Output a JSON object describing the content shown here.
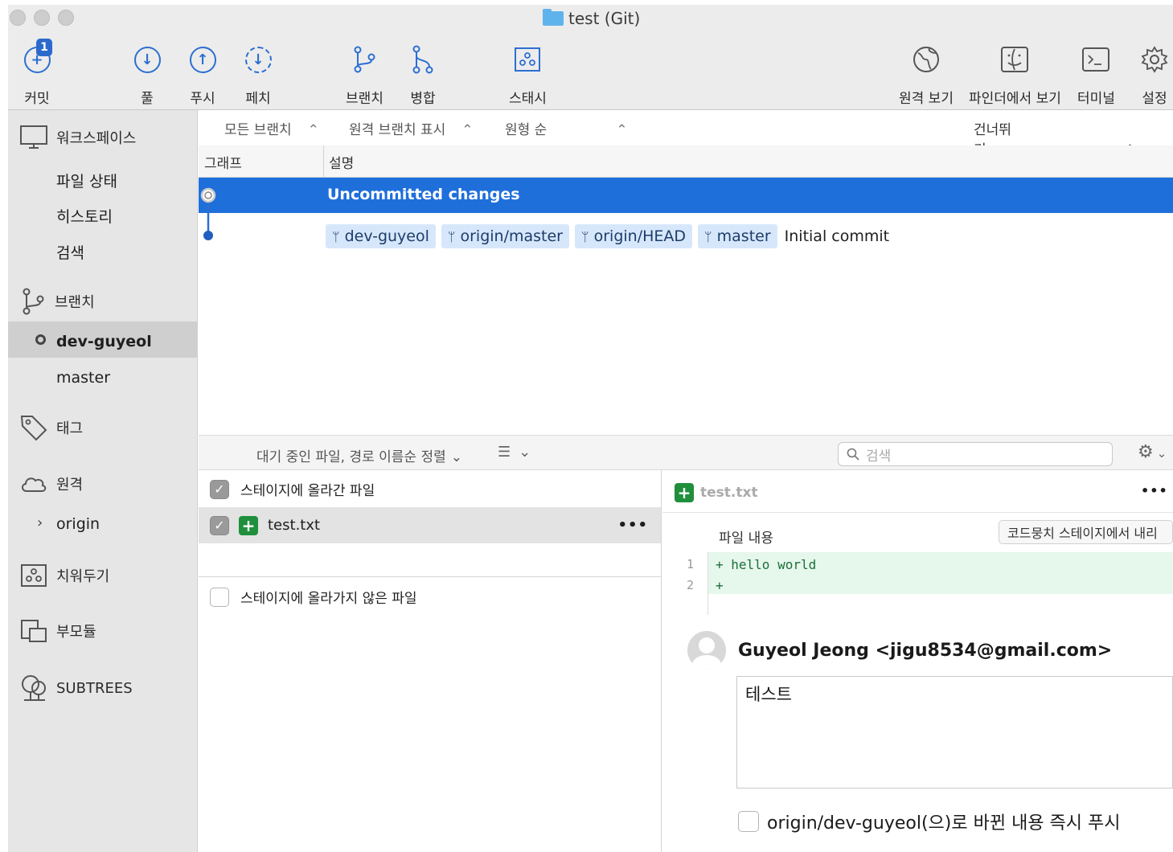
{
  "window": {
    "title": "test (Git)"
  },
  "toolbar": {
    "commit": {
      "label": "커밋",
      "badge": "1"
    },
    "pull": "풀",
    "push": "푸시",
    "fetch": "페치",
    "branch": "브랜치",
    "merge": "병합",
    "stash": "스태시",
    "remote_view": "원격 보기",
    "finder": "파인더에서 보기",
    "terminal": "터미널",
    "settings": "설정"
  },
  "sidebar": {
    "workspace": {
      "header": "워크스페이스",
      "items": [
        "파일 상태",
        "히스토리",
        "검색"
      ]
    },
    "branches": {
      "header": "브랜치",
      "items": [
        "dev-guyeol",
        "master"
      ]
    },
    "tags": {
      "header": "태그"
    },
    "remotes": {
      "header": "원격",
      "items": [
        "origin"
      ]
    },
    "stashes": {
      "header": "치워두기"
    },
    "submodules": {
      "header": "부모듈"
    },
    "subtrees": {
      "header": "SUBTREES"
    }
  },
  "filter": {
    "branches": "모든 브랜치",
    "remote": "원격 브랜치 표시",
    "order": "원형 순",
    "jump": "건너뛰기:"
  },
  "columns": {
    "graph": "그래프",
    "description": "설명"
  },
  "commits": [
    {
      "text": "Uncommitted changes",
      "selected": true
    },
    {
      "refs": [
        "dev-guyeol",
        "origin/master",
        "origin/HEAD",
        "master"
      ],
      "text": "Initial commit"
    }
  ],
  "stage_bar": {
    "sort": "대기 중인 파일, 경로 이름순 정렬",
    "search_placeholder": "검색"
  },
  "staged": {
    "header": "스테이지에 올라간 파일",
    "files": [
      {
        "name": "test.txt",
        "more": "•••"
      }
    ]
  },
  "unstaged": {
    "header": "스테이지에 올라가지 않은 파일"
  },
  "diff": {
    "file": "test.txt",
    "more": "•••",
    "section": "파일 내용",
    "unstage_button": "코드뭉치 스테이지에서 내리",
    "lines": [
      {
        "num": "1",
        "text": "+ hello world"
      },
      {
        "num": "2",
        "text": "+"
      }
    ]
  },
  "commit_box": {
    "author": "Guyeol Jeong <jigu8534@gmail.com>",
    "message": "테스트",
    "push_option": "origin/dev-guyeol(으)로 바뀐 내용 즉시 푸시"
  },
  "colors": {
    "accent": "#2c6fd1",
    "selection": "#1f6fdb",
    "ref_tag": "#d7e7fb",
    "added_line": "#e6f7ec"
  }
}
